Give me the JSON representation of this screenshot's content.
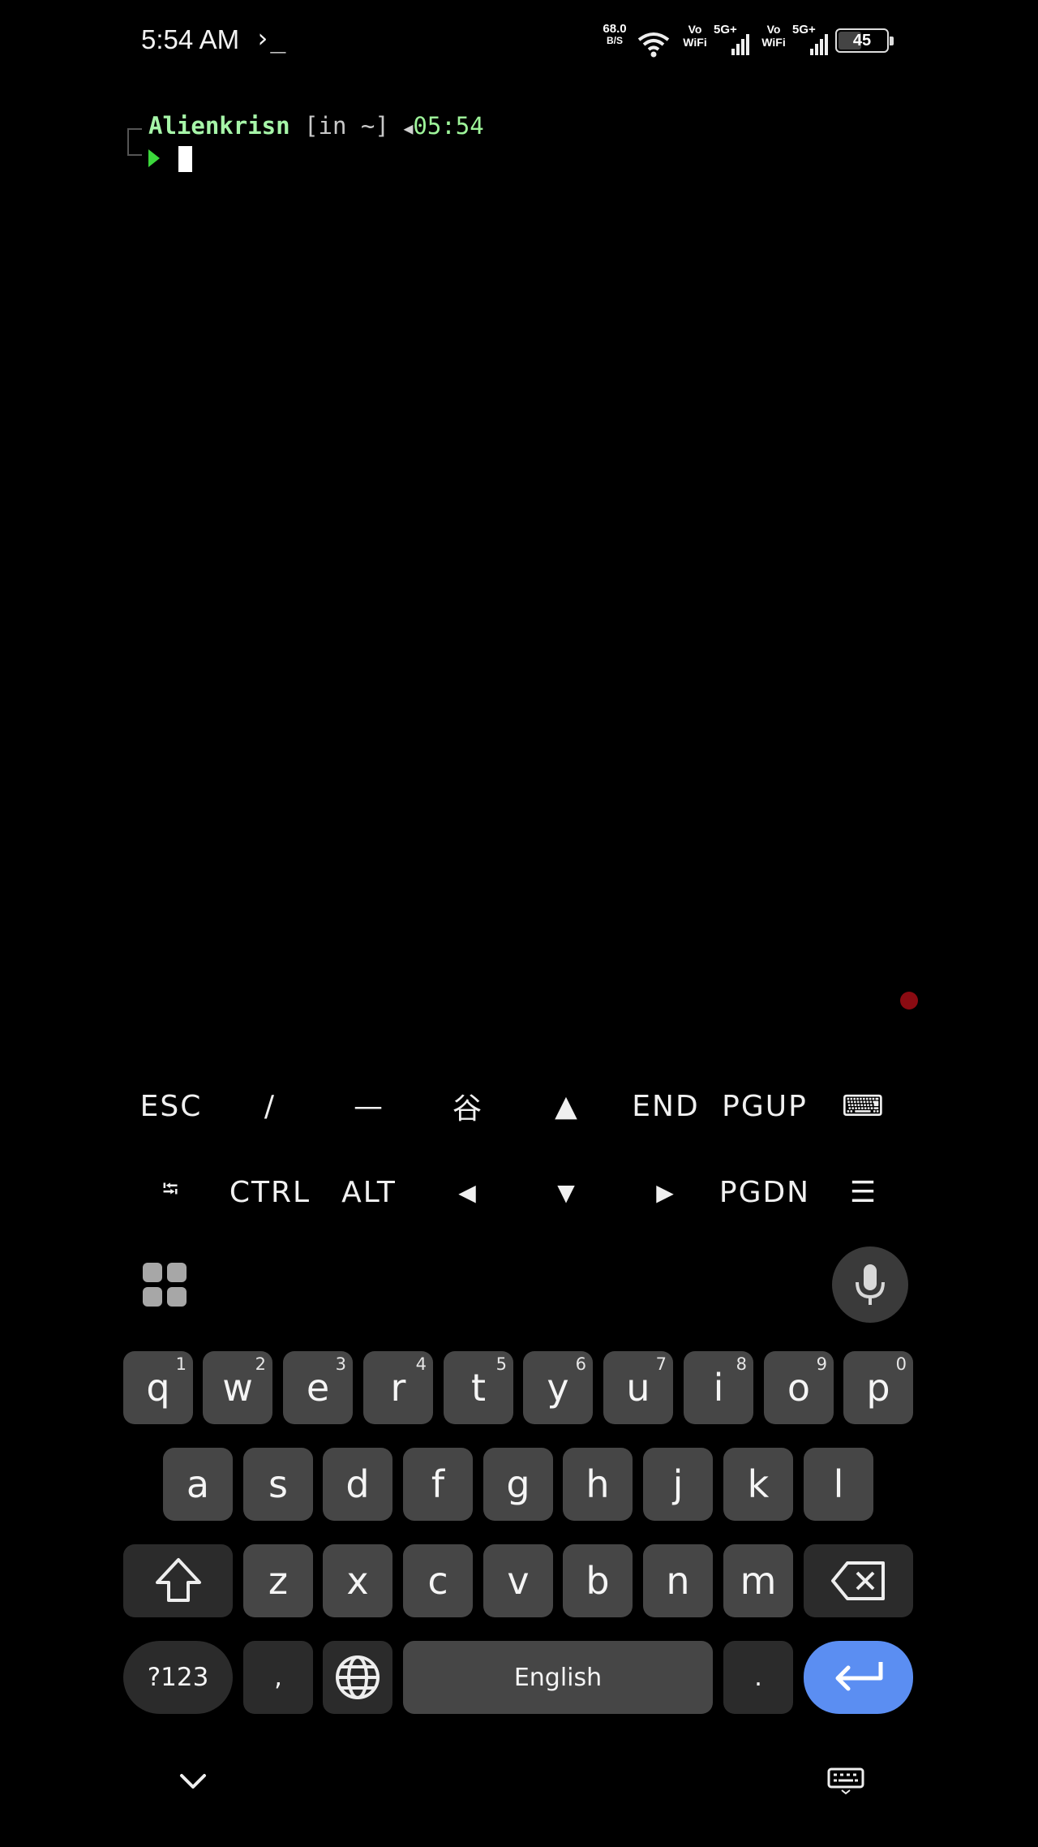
{
  "status_bar": {
    "time": "5:54 AM",
    "terminal_indicator": "›_",
    "net_speed_value": "68.0",
    "net_speed_unit": "B/S",
    "sim1_label_top": "Vo",
    "sim1_label_bottom": "WiFi",
    "sim1_network": "5G+",
    "sim2_label_top": "Vo",
    "sim2_label_bottom": "WiFi",
    "sim2_network": "5G+",
    "battery_level": "45"
  },
  "terminal": {
    "user": "Alienkrisn",
    "directory": "[in ~]",
    "arrow": "◀",
    "time": "05:54",
    "prompt_color": "#3cd83c"
  },
  "extra_keys": {
    "row1": [
      "ESC",
      "/",
      "—",
      "谷",
      "▲",
      "END",
      "PGUP",
      "⌨"
    ],
    "row2": [
      "⭾",
      "CTRL",
      "ALT",
      "◀",
      "▼",
      "▶",
      "PGDN",
      "☰"
    ]
  },
  "keyboard": {
    "row1": [
      {
        "k": "q",
        "h": "1"
      },
      {
        "k": "w",
        "h": "2"
      },
      {
        "k": "e",
        "h": "3"
      },
      {
        "k": "r",
        "h": "4"
      },
      {
        "k": "t",
        "h": "5"
      },
      {
        "k": "y",
        "h": "6"
      },
      {
        "k": "u",
        "h": "7"
      },
      {
        "k": "i",
        "h": "8"
      },
      {
        "k": "o",
        "h": "9"
      },
      {
        "k": "p",
        "h": "0"
      }
    ],
    "row2": [
      "a",
      "s",
      "d",
      "f",
      "g",
      "h",
      "j",
      "k",
      "l"
    ],
    "row3": [
      "z",
      "x",
      "c",
      "v",
      "b",
      "n",
      "m"
    ],
    "symbols_label": "?123",
    "comma_label": ",",
    "space_label": "English",
    "period_label": ".",
    "enter_color": "#5b8ef2",
    "key_color": "#464646"
  },
  "icons": {
    "shift": "shift-icon",
    "backspace": "backspace-icon",
    "globe": "globe-icon",
    "enter": "enter-icon",
    "mic": "mic-icon",
    "apps": "apps-grid-icon",
    "hide": "chevron-down-icon",
    "kb_switch": "keyboard-icon"
  }
}
